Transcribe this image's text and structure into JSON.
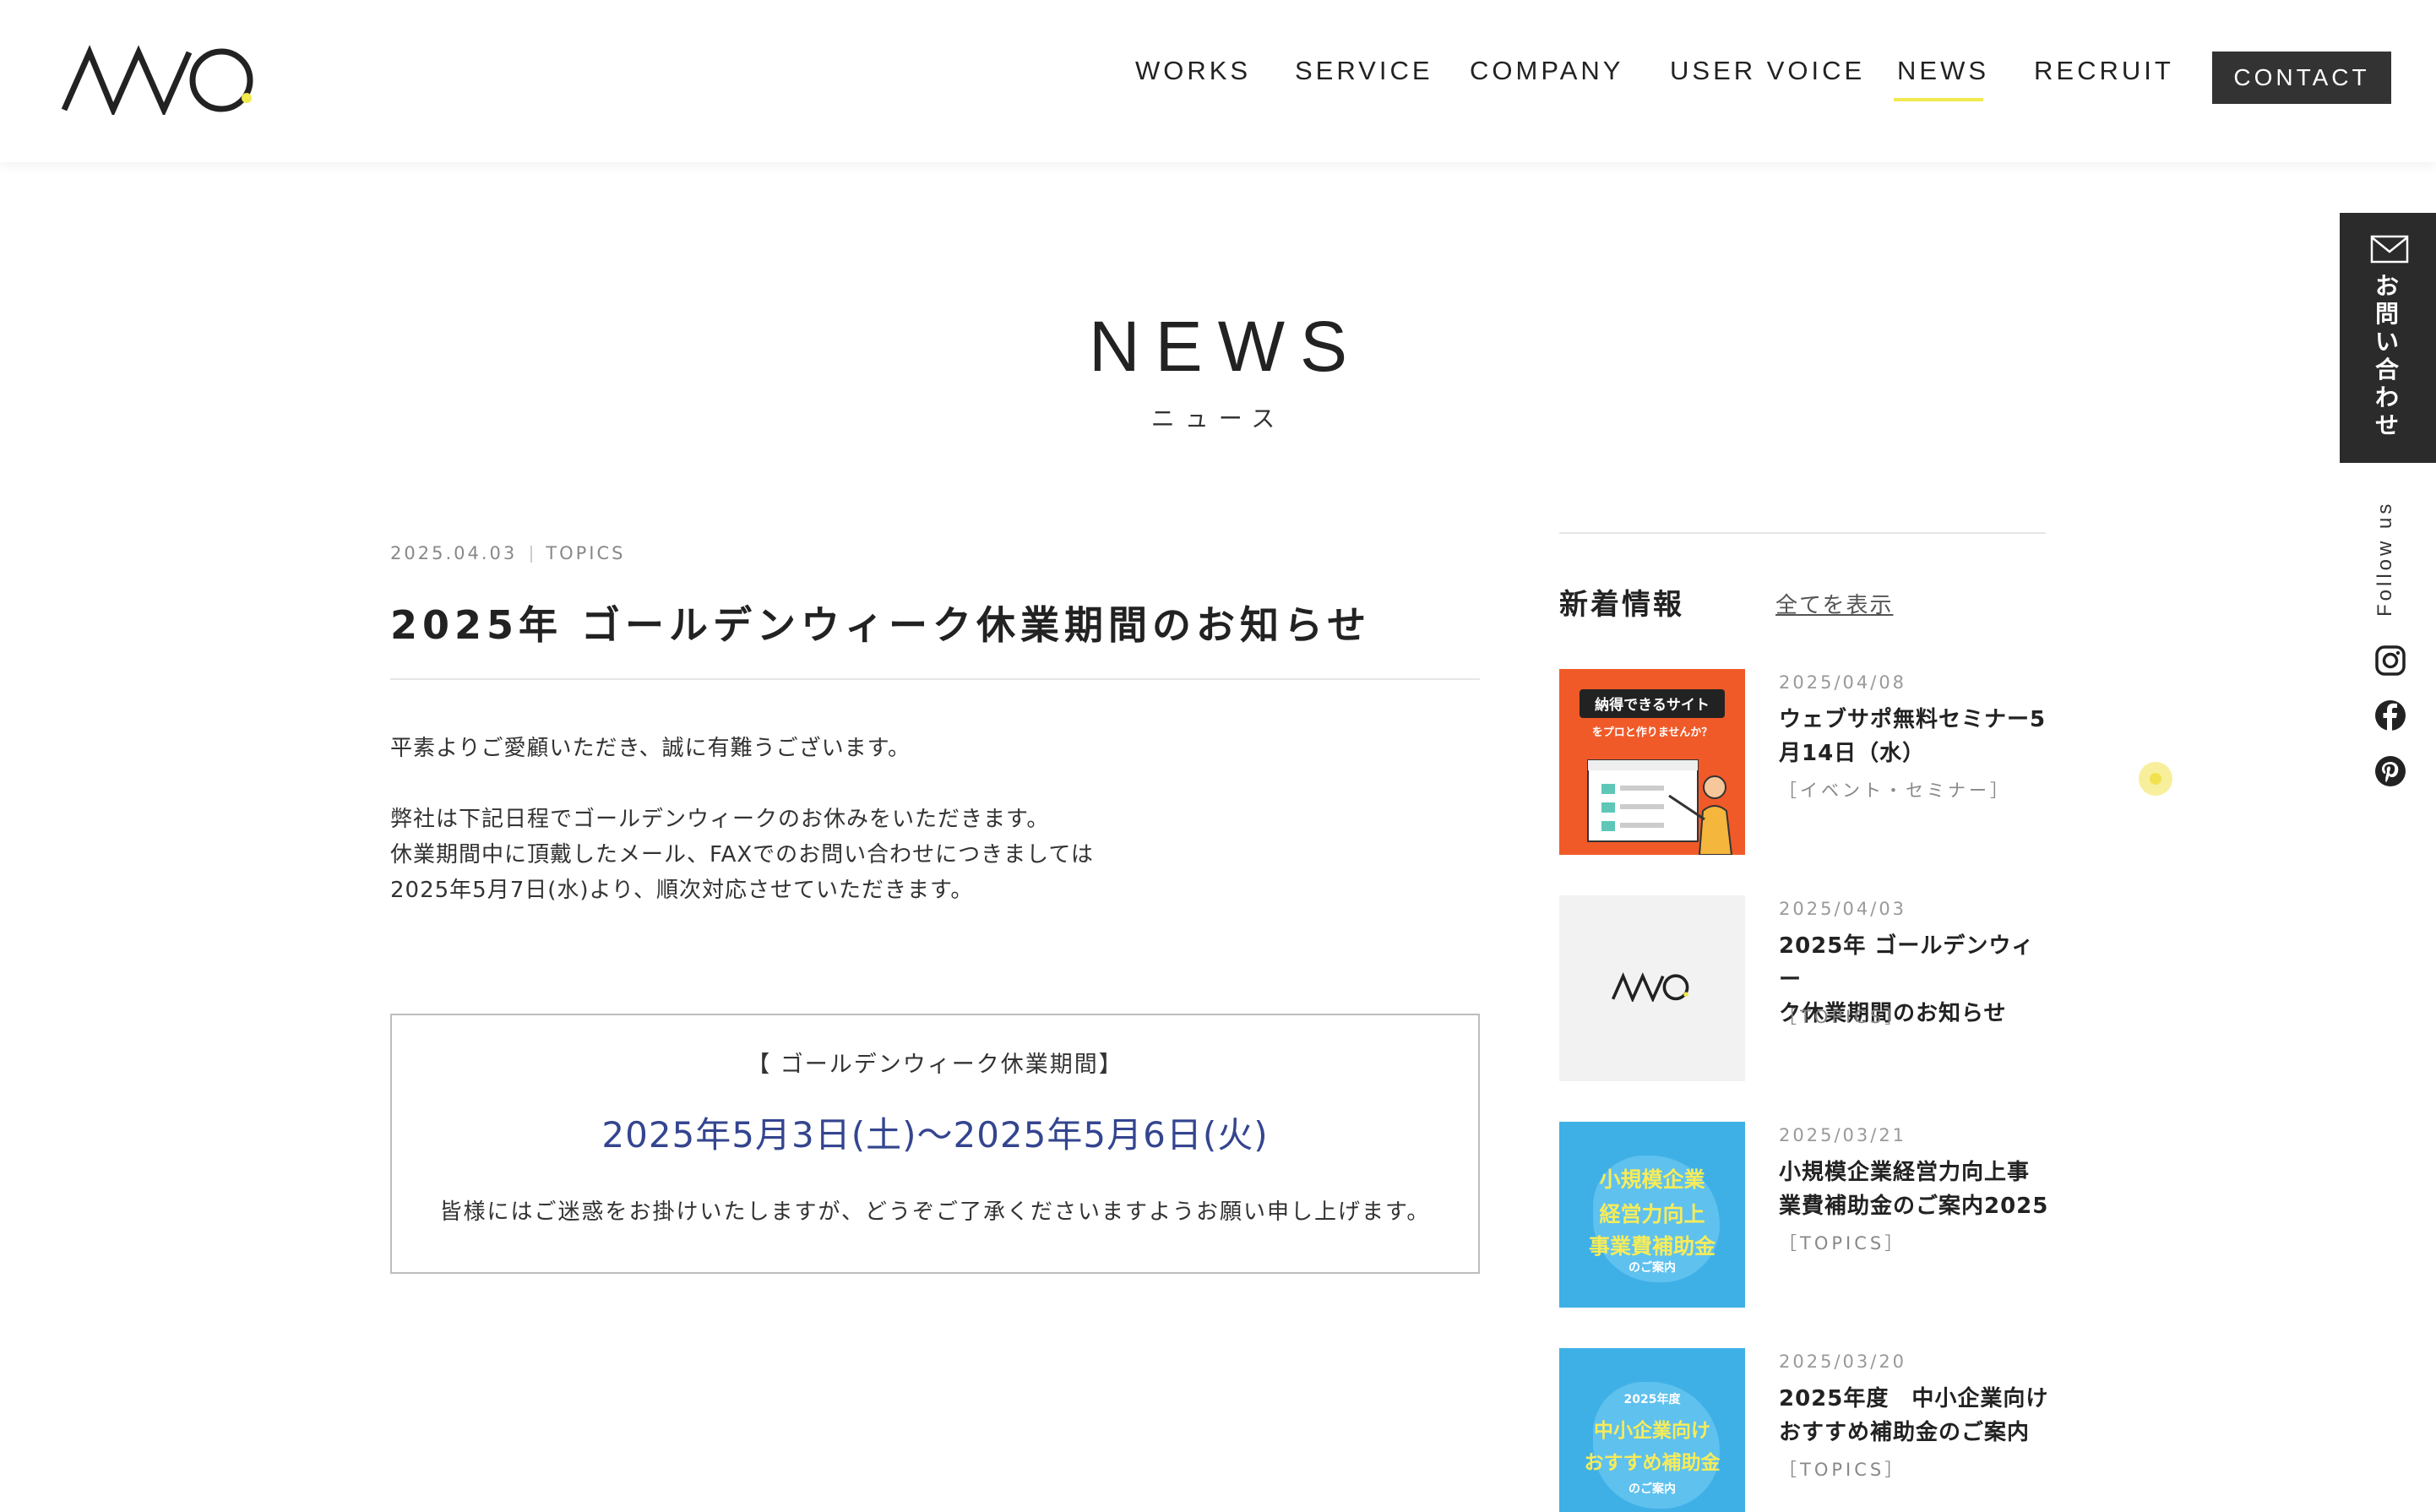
{
  "header": {
    "logo_alt": "MO",
    "nav": [
      "WORKS",
      "SERVICE",
      "COMPANY",
      "USER VOICE",
      "NEWS",
      "RECRUIT"
    ],
    "active_nav": "NEWS",
    "contact_label": "CONTACT"
  },
  "side_rail": {
    "contact_vertical": [
      "お",
      "問",
      "い",
      "合",
      "わ",
      "せ"
    ],
    "follow_label": "Follow us",
    "sns_icons": [
      "instagram-icon",
      "facebook-icon",
      "pinterest-icon"
    ]
  },
  "page": {
    "title": "NEWS",
    "subtitle": "ニュース"
  },
  "article": {
    "date": "2025.04.03",
    "category": "TOPICS",
    "title": "2025年 ゴールデンウィーク休業期間のお知らせ",
    "paragraphs": [
      "平素よりご愛顧いただき、誠に有難うございます。",
      "弊社は下記日程でゴールデンウィークのお休みをいただきます。",
      "休業期間中に頂戴したメール、FAXでのお問い合わせにつきましては",
      "2025年5月7日(水)より、順次対応させていただきます。"
    ],
    "notice": {
      "heading": "【 ゴールデンウィーク休業期間】",
      "dates": "2025年5月3日(土)〜2025年5月6日(火)",
      "footer": "皆様にはご迷惑をお掛けいたしますが、どうぞご了承くださいますようお願い申し上げます。"
    }
  },
  "sidebar": {
    "heading": "新着情報",
    "view_all": "全てを表示",
    "items": [
      {
        "date": "2025/04/08",
        "title_lines": [
          "ウェブサポ無料セミナー5",
          "月14日（水）"
        ],
        "category": "［イベント・セミナー］",
        "thumb_lines": [
          "納得できるサイト",
          "をプロと作りませんか？"
        ]
      },
      {
        "date": "2025/04/03",
        "title_lines": [
          "2025年 ゴールデンウィー",
          "ク休業期間のお知らせ"
        ],
        "category": "［TOPICS］",
        "thumb_lines": []
      },
      {
        "date": "2025/03/21",
        "title_lines": [
          "小規模企業経営力向上事",
          "業費補助金のご案内2025"
        ],
        "category": "［TOPICS］",
        "thumb_lines": [
          "小規模企業",
          "経営力向上",
          "事業費補助金",
          "のご案内"
        ]
      },
      {
        "date": "2025/03/20",
        "title_lines": [
          "2025年度　中小企業向け",
          "おすすめ補助金のご案内"
        ],
        "category": "［TOPICS］",
        "thumb_lines": [
          "2025年度",
          "中小企業向け",
          "おすすめ補助金",
          "のご案内"
        ]
      }
    ]
  },
  "colors": {
    "accent_yellow": "#f2e94e",
    "dark": "#2b2b2b",
    "date_blue": "#34458f",
    "thumb_orange": "#f05a28",
    "thumb_blue": "#3fb0e6",
    "thumb_yellow_text": "#f6ec5a"
  }
}
